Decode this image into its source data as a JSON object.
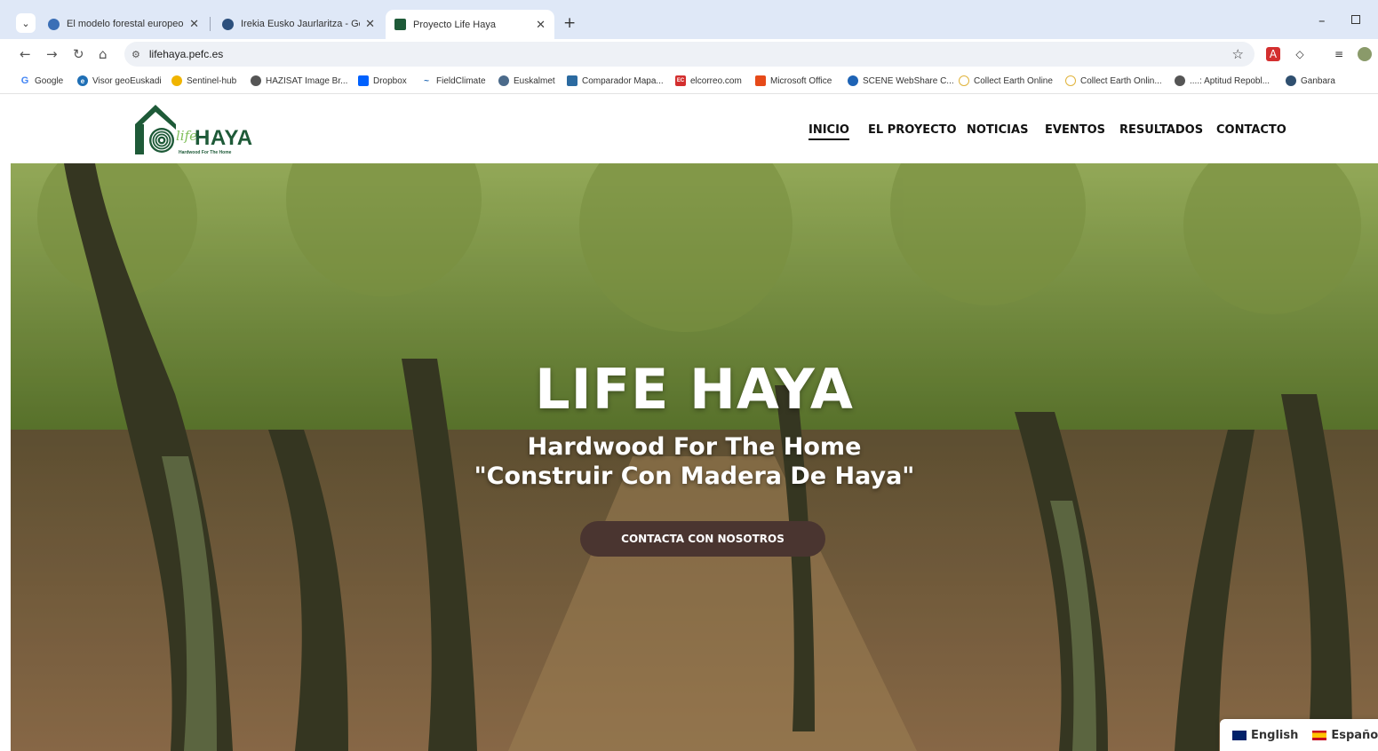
{
  "browser": {
    "tabs": [
      {
        "title": "El modelo forestal europeo, a",
        "active": false
      },
      {
        "title": "Irekia Eusko Jaurlaritza - Gobie",
        "active": false
      },
      {
        "title": "Proyecto Life Haya",
        "active": true
      }
    ],
    "url": "lifehaya.pefc.es",
    "bookmarks": [
      "Google",
      "Visor geoEuskadi",
      "Sentinel-hub",
      "HAZISAT Image Br...",
      "Dropbox",
      "FieldClimate",
      "Euskalmet",
      "Comparador Mapa...",
      "elcorreo.com",
      "Microsoft Office",
      "SCENE WebShare C...",
      "Collect Earth Online",
      "Collect Earth Onlin...",
      "....: Aptitud Repobl...",
      "Ganbara"
    ]
  },
  "site": {
    "logo_text": "HAYA",
    "logo_script": "life",
    "logo_tagline": "Hardwood For The Home",
    "menu": [
      "INICIO",
      "EL PROYECTO",
      "NOTICIAS",
      "EVENTOS",
      "RESULTADOS",
      "CONTACTO"
    ],
    "active_menu": "INICIO"
  },
  "hero": {
    "title": "LIFE HAYA",
    "subtitle_line1": "Hardwood For The Home",
    "subtitle_line2": "\"Construir Con Madera De Haya\"",
    "cta_label": "CONTACTA CON NOSOTROS"
  },
  "languages": [
    "English",
    "Español"
  ],
  "colors": {
    "brand_green": "#1e5a38",
    "cta_brown": "#4a3530",
    "chrome_blue": "#dfe8f7"
  }
}
